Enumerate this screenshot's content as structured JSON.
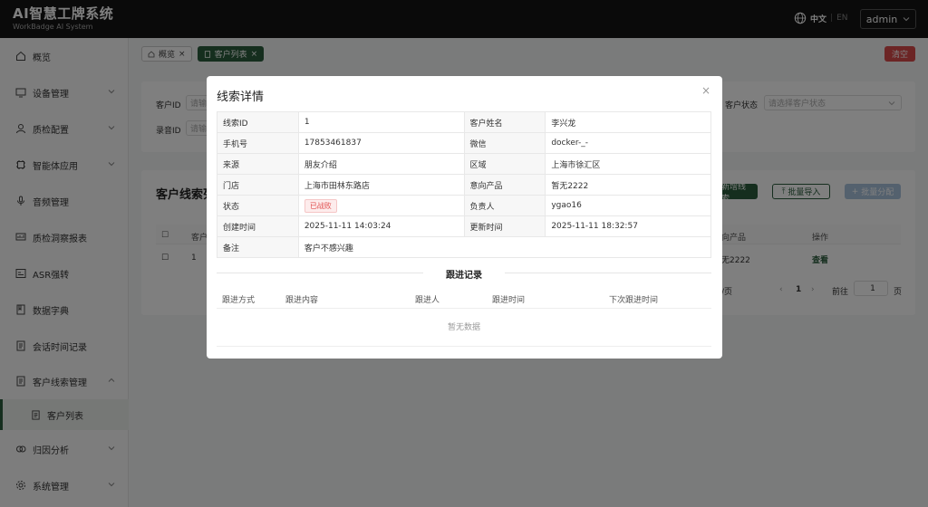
{
  "header": {
    "app_title": "AI智慧工牌系统",
    "app_subtitle": "WorkBadge AI System",
    "lang_current": "中文",
    "lang_sep": "|",
    "lang_alt": "EN",
    "user": "admin"
  },
  "sidebar": {
    "items": [
      {
        "label": "概览",
        "icon": "home-icon"
      },
      {
        "label": "设备管理",
        "icon": "monitor-icon"
      },
      {
        "label": "质检配置",
        "icon": "user-icon"
      },
      {
        "label": "智能体应用",
        "icon": "chip-icon"
      },
      {
        "label": "音频管理",
        "icon": "microphone-icon"
      },
      {
        "label": "质检洞察报表",
        "icon": "report-icon"
      },
      {
        "label": "ASR强转",
        "icon": "asr-icon"
      },
      {
        "label": "数据字典",
        "icon": "book-icon"
      },
      {
        "label": "会话时间记录",
        "icon": "document-icon"
      },
      {
        "label": "客户线索管理",
        "icon": "document-icon"
      },
      {
        "label": "归因分析",
        "icon": "analysis-icon"
      },
      {
        "label": "系统管理",
        "icon": "gear-icon"
      }
    ],
    "sub_active": "客户列表"
  },
  "tabs": [
    {
      "label": "概览",
      "icon": "home-icon"
    },
    {
      "label": "客户列表",
      "icon": "document-icon"
    }
  ],
  "clear_label": "清空",
  "filters": {
    "customer_id_label": "客户ID",
    "customer_id_placeholder": "请输",
    "audio_id_label": "录音ID",
    "audio_id_placeholder": "请输",
    "status_label": "客户状态",
    "status_placeholder": "请选择客户状态"
  },
  "list": {
    "title": "客户线索列",
    "add_label": "新增线索",
    "import_label": "批量导入",
    "assign_label": "批量分配",
    "col_customer": "客户",
    "col_product": "向产品",
    "col_action": "操作",
    "row_id": "1",
    "row_product": "无2222",
    "row_action": "查看",
    "page_size": "/页",
    "page_num": "1",
    "goto_label": "前往",
    "goto_value": "1",
    "page_suffix": "页"
  },
  "modal": {
    "title": "线索详情",
    "close": "×",
    "fields": {
      "lead_id_label": "线索ID",
      "lead_id": "1",
      "name_label": "客户姓名",
      "name": "李兴龙",
      "phone_label": "手机号",
      "phone": "17853461837",
      "wechat_label": "微信",
      "wechat": "docker-_-",
      "source_label": "来源",
      "source": "朋友介绍",
      "region_label": "区域",
      "region": "上海市徐汇区",
      "store_label": "门店",
      "store": "上海市田林东路店",
      "product_label": "意向产品",
      "product": "暂无2222",
      "status_label": "状态",
      "status": "已战败",
      "owner_label": "负责人",
      "owner": "ygao16",
      "created_label": "创建时间",
      "created": "2025-11-11 14:03:24",
      "updated_label": "更新时间",
      "updated": "2025-11-11 18:32:57",
      "remark_label": "备注",
      "remark": "客户不感兴趣"
    },
    "followup": {
      "title": "跟进记录",
      "cols": [
        "跟进方式",
        "跟进内容",
        "跟进人",
        "跟进时间",
        "下次跟进时间"
      ],
      "empty": "暂无数据"
    }
  },
  "colors": {
    "accent": "#2a5d3c",
    "danger": "#d94a4a",
    "header_bg": "#141414"
  }
}
